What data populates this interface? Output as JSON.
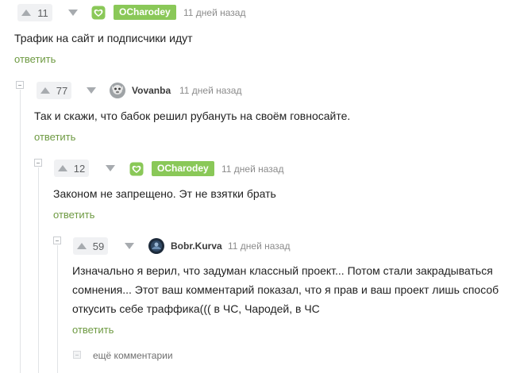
{
  "comments": [
    {
      "votes": "11",
      "author": "OCharodey",
      "author_is_badge": true,
      "time": "11 дней назад",
      "text": "Трафик на сайт и подписчики идут",
      "reply_label": "ответить"
    },
    {
      "votes": "77",
      "author": "Vovanba",
      "author_is_badge": false,
      "time": "11 дней назад",
      "text": "Так и скажи, что бабок решил рубануть на своём говносайте.",
      "reply_label": "ответить"
    },
    {
      "votes": "12",
      "author": "OCharodey",
      "author_is_badge": true,
      "time": "11 дней назад",
      "text": "Законом не запрещено. Эт не взятки брать",
      "reply_label": "ответить"
    },
    {
      "votes": "59",
      "author": "Bobr.Kurva",
      "author_is_badge": false,
      "time": "11 дней назад",
      "text_lines": [
        "Изначально я верил, что задуман классный проект... Потом стали закрадываться",
        "сомнения... Этот ваш комментарий показал, что я прав и ваш проект лишь способ",
        "откусить себе траффика((( в ЧС, Чародей, в ЧС"
      ],
      "reply_label": "ответить"
    }
  ],
  "more_comments_label": "ещё комментарии",
  "colors": {
    "accent_green": "#8ac858",
    "reply_green": "#6e9a42",
    "vote_bg": "#f0f1f3"
  },
  "icons": [
    "arrow-up-icon",
    "arrow-down-icon",
    "heart-icon",
    "collapse-icon",
    "expand-icon"
  ]
}
